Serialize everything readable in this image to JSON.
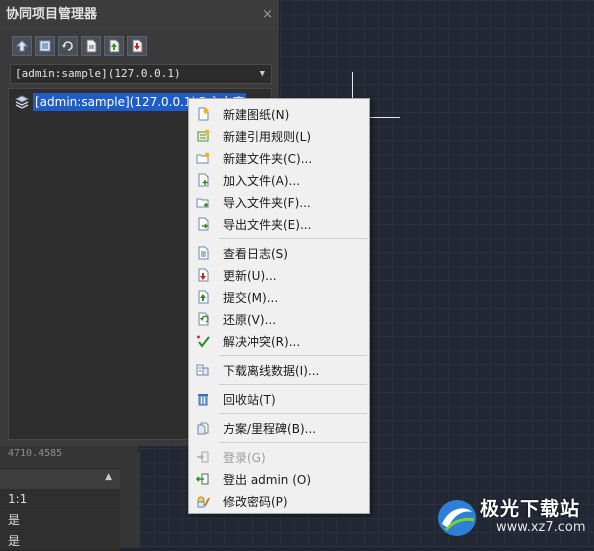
{
  "panel": {
    "title": "协同项目管理器",
    "close_glyph": "×",
    "toolbar": [
      {
        "icon": "sync-project-icon"
      },
      {
        "icon": "list-view-icon"
      },
      {
        "icon": "refresh-icon"
      },
      {
        "icon": "document-icon"
      },
      {
        "icon": "upload-icon"
      },
      {
        "icon": "download-icon"
      }
    ],
    "project_select": {
      "value": "[admin:sample](127.0.0.1)"
    },
    "tree": {
      "selected_node": "[admin:sample](127.0.0.1)@主文库"
    }
  },
  "properties": {
    "coordinate": "4710.4585",
    "rows": [
      "1:1",
      "是",
      "是"
    ]
  },
  "context_menu": {
    "items": [
      {
        "label": "新建图纸(N)",
        "icon": "new-drawing-icon",
        "enabled": true
      },
      {
        "label": "新建引用规则(L)",
        "icon": "new-reference-rule-icon",
        "enabled": true
      },
      {
        "label": "新建文件夹(C)...",
        "icon": "new-folder-icon",
        "enabled": true
      },
      {
        "label": "加入文件(A)...",
        "icon": "add-file-icon",
        "enabled": true
      },
      {
        "label": "导入文件夹(F)...",
        "icon": "import-folder-icon",
        "enabled": true
      },
      {
        "label": "导出文件夹(E)...",
        "icon": "export-folder-icon",
        "enabled": true
      },
      {
        "label": "查看日志(S)",
        "icon": "view-log-icon",
        "enabled": true
      },
      {
        "label": "更新(U)...",
        "icon": "update-icon",
        "enabled": true
      },
      {
        "label": "提交(M)...",
        "icon": "commit-icon",
        "enabled": true
      },
      {
        "label": "还原(V)...",
        "icon": "revert-icon",
        "enabled": true
      },
      {
        "label": "解决冲突(R)...",
        "icon": "resolve-conflict-icon",
        "enabled": true
      },
      {
        "label": "下载离线数据(I)...",
        "icon": "download-offline-icon",
        "enabled": true
      },
      {
        "label": "回收站(T)",
        "icon": "recycle-bin-icon",
        "enabled": true
      },
      {
        "label": "方案/里程碑(B)...",
        "icon": "milestone-icon",
        "enabled": true
      },
      {
        "label": "登录(G)",
        "icon": "login-icon",
        "enabled": false
      },
      {
        "label": "登出 admin (O)",
        "icon": "logout-icon",
        "enabled": true
      },
      {
        "label": "修改密码(P)",
        "icon": "change-password-icon",
        "enabled": true
      }
    ]
  },
  "watermark": {
    "title": "极光下载站",
    "url": "www.xz7.com"
  },
  "colors": {
    "selection": "#1e5cc8",
    "menu_bg": "#f0f0f0",
    "panel_bg": "#3a3a3a"
  }
}
